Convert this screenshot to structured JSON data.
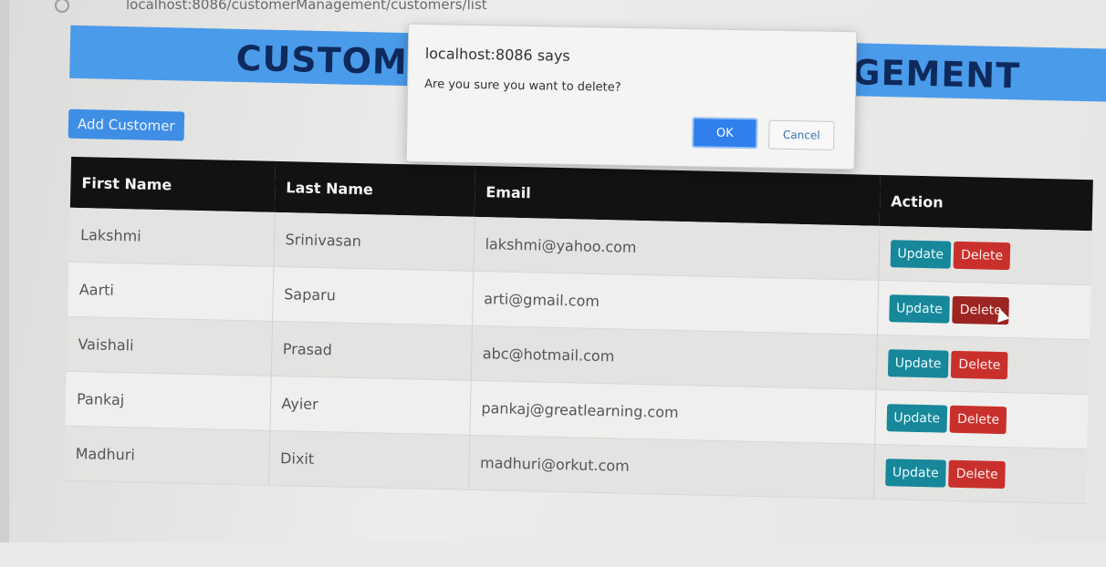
{
  "browser": {
    "url": "localhost:8086/customerManagement/customers/list"
  },
  "header": {
    "title_left": "CUSTOM",
    "title_right": "GEMENT"
  },
  "toolbar": {
    "add_label": "Add Customer"
  },
  "table": {
    "headers": [
      "First Name",
      "Last Name",
      "Email",
      "Action"
    ],
    "rows": [
      {
        "first": "Lakshmi",
        "last": "Srinivasan",
        "email": "lakshmi@yahoo.com"
      },
      {
        "first": "Aarti",
        "last": "Saparu",
        "email": "arti@gmail.com"
      },
      {
        "first": "Vaishali",
        "last": "Prasad",
        "email": "abc@hotmail.com"
      },
      {
        "first": "Pankaj",
        "last": "Ayier",
        "email": "pankaj@greatlearning.com"
      },
      {
        "first": "Madhuri",
        "last": "Dixit",
        "email": "madhuri@orkut.com"
      }
    ],
    "update_label": "Update",
    "delete_label": "Delete"
  },
  "dialog": {
    "title": "localhost:8086 says",
    "message": "Are you sure you want to delete?",
    "ok_label": "OK",
    "cancel_label": "Cancel"
  },
  "colors": {
    "banner": "#4a9bea",
    "title_text": "#0e2a5c",
    "add_button": "#3f8ee6",
    "table_header": "#121212",
    "update_button": "#17879a",
    "delete_button": "#c9302c",
    "dialog_ok": "#2f80ed"
  }
}
